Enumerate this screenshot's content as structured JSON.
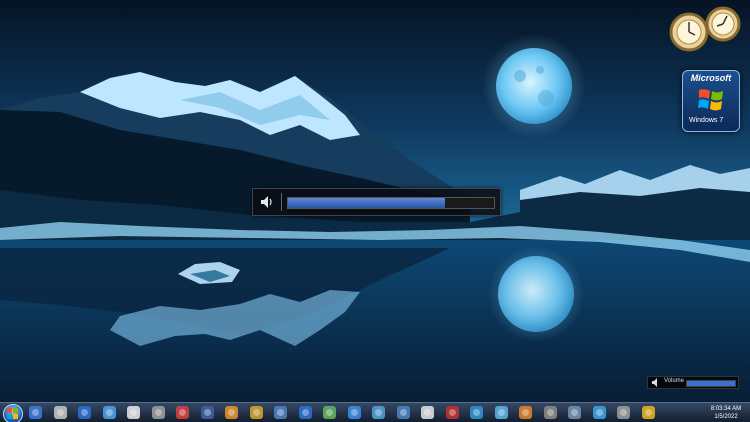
{
  "gadgets": {
    "logo": {
      "brand": "Microsoft",
      "product": "Windows 7"
    }
  },
  "volume_osd": {
    "level_percent": 76
  },
  "volume_mini": {
    "label": "Volume",
    "level_percent": 100
  },
  "taskbar": {
    "icons": [
      "windows-explorer-icon",
      "screenshot-skull-icon",
      "media-center-icon",
      "monitor-icon",
      "dollar-icon",
      "disc-icon",
      "film-icon",
      "shaded-folder-icon",
      "painter-palette-icon",
      "paint-bucket-icon",
      "globe-tools-icon",
      "hp-icon",
      "battery-icon",
      "internet-explorer-icon",
      "messenger-icon",
      "connect-icon",
      "pirate-icon",
      "flag-icon",
      "mail-globe-icon",
      "network-icon",
      "firefox-icon",
      "disc-drive-icon",
      "cloud-icon",
      "circle-app-icon",
      "torch-icon",
      "chrome-icon"
    ],
    "tray": {
      "time": "8:03:34 AM",
      "date": "1/5/2022"
    }
  },
  "colors": {
    "sky_top": "#0a1d36",
    "sky_mid": "#14456e",
    "water": "#0c3358",
    "mountain_snow": "#bfe6ff",
    "taskbar": "#1a2a40"
  }
}
